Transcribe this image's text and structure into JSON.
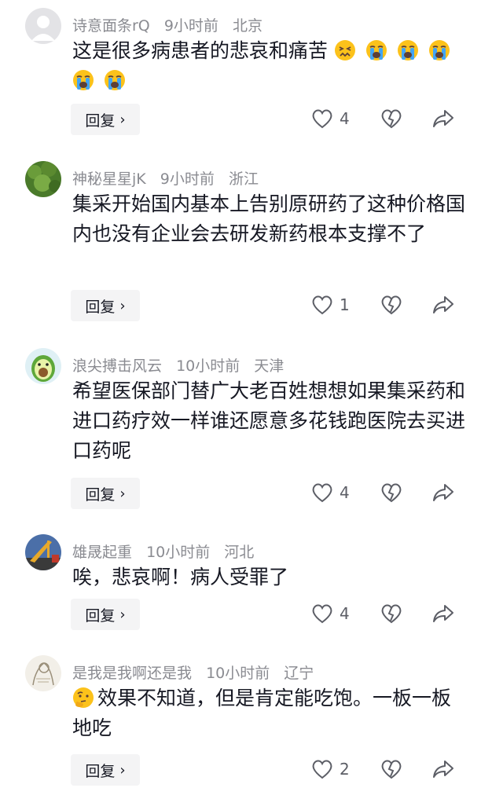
{
  "comments": [
    {
      "username": "诗意面条rQ",
      "time": "9小时前",
      "location": "北京",
      "text": "这是很多病患者的悲哀和痛苦",
      "trailing_emojis": [
        "confounded-face",
        "crying-face",
        "crying-face",
        "crying-face",
        "crying-face",
        "crying-face"
      ],
      "avatar": "default-avatar",
      "like_count": "4",
      "reply_label": "回复"
    },
    {
      "username": "神秘星星jK",
      "time": "9小时前",
      "location": "浙江",
      "text": "集采开始国内基本上告别原研药了这种价格国内也没有企业会去研发新药根本支撑不了",
      "avatar": "green-plant-avatar",
      "like_count": "1",
      "reply_label": "回复"
    },
    {
      "username": "浪尖搏击风云",
      "time": "10小时前",
      "location": "天津",
      "text": "希望医保部门替广大老百姓想想如果集采药和进口药疗效一样谁还愿意多花钱跑医院去买进口药呢",
      "avatar": "avocado-avatar",
      "like_count": "4",
      "reply_label": "回复"
    },
    {
      "username": "雄晟起重",
      "time": "10小时前",
      "location": "河北",
      "text": "唉，悲哀啊！病人受罪了",
      "avatar": "crane-avatar",
      "like_count": "4",
      "reply_label": "回复"
    },
    {
      "username": "是我是我啊还是我",
      "time": "10小时前",
      "location": "辽宁",
      "text": "效果不知道，但是肯定能吃饱。一板一板地吃",
      "leading_emoji": "thinking-face",
      "avatar": "sketch-avatar",
      "like_count": "2",
      "reply_label": "回复"
    }
  ],
  "colors": {
    "meta_gray": "#8a8b91",
    "text": "#161823",
    "reply_bg": "#f4f4f5",
    "icon_gray": "#5c5e66"
  }
}
